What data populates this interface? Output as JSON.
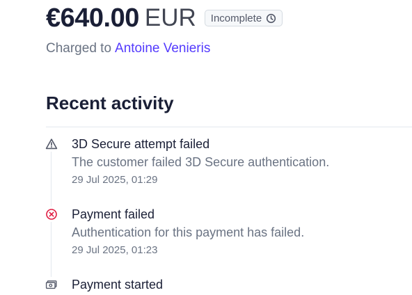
{
  "payment": {
    "amount": "€640.00",
    "currency": "EUR",
    "status": "Incomplete",
    "status_icon": "clock-icon",
    "charged_to_label": "Charged to",
    "customer_name": "Antoine Venieris"
  },
  "activity": {
    "title": "Recent activity",
    "events": [
      {
        "title": "3D Secure attempt failed",
        "description": "The customer failed 3D Secure authentication.",
        "timestamp": "29 Jul 2025, 01:29",
        "icon": "warning-icon"
      },
      {
        "title": "Payment failed",
        "description": "Authentication for this payment has failed.",
        "timestamp": "29 Jul 2025, 01:23",
        "icon": "error-circle-icon",
        "icon_color": "#df1b41"
      },
      {
        "title": "Payment started",
        "icon": "banknote-icon"
      }
    ]
  }
}
